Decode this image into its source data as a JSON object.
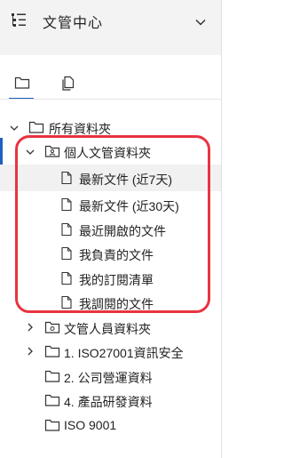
{
  "header": {
    "title": "文管中心",
    "app_icon": "tree-list-icon",
    "collapse_icon": "chevron-down-icon"
  },
  "tabs": [
    {
      "name": "folders",
      "icon": "folder-icon",
      "active": true
    },
    {
      "name": "pages",
      "icon": "pages-icon",
      "active": false
    }
  ],
  "colors": {
    "accent": "#1f5fbf",
    "highlight": "#e8343f",
    "header_bg": "#f3f3f3"
  },
  "tree": {
    "root": {
      "label": "所有資料夾",
      "expanded": true
    },
    "personal": {
      "label": "個人文管資料夾",
      "expanded": true
    },
    "personal_items": [
      {
        "label": "最新文件 (近7天)",
        "selected": true
      },
      {
        "label": "最新文件 (近30天)"
      },
      {
        "label": "最近開啟的文件"
      },
      {
        "label": "我負責的文件"
      },
      {
        "label": "我的訂閱清單"
      },
      {
        "label": "我調閱的文件"
      }
    ],
    "folders": [
      {
        "label": "文管人員資料夾",
        "expandable": true
      },
      {
        "label": "1. ISO27001資訊安全",
        "expandable": true
      },
      {
        "label": "2. 公司營運資料",
        "expandable": false
      },
      {
        "label": "4. 產品研發資料",
        "expandable": false
      },
      {
        "label": "ISO 9001",
        "expandable": false
      }
    ]
  }
}
